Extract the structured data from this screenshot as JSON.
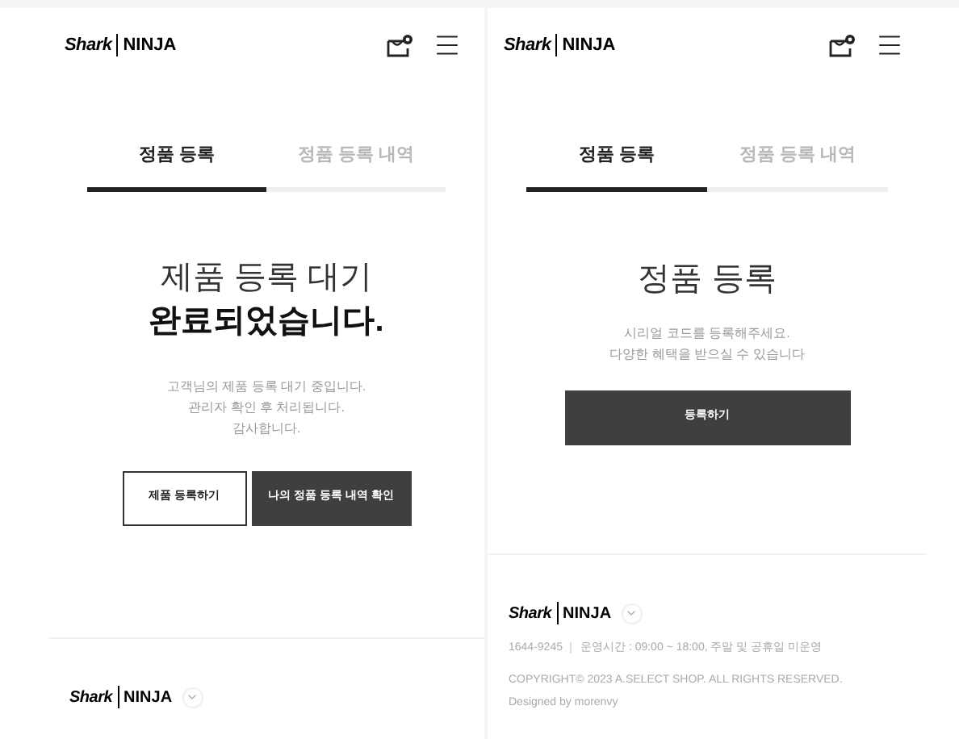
{
  "screens": [
    {
      "kind": "complete",
      "brand": {
        "left": "Shark",
        "right": "NINJA"
      },
      "tabs": [
        {
          "label": "정품 등록",
          "selected": true
        },
        {
          "label": "정품 등록 내역",
          "selected": false
        }
      ],
      "title": "제품 등록 대기",
      "title_bold": "완료되었습니다.",
      "message": [
        "고객님의 제품 등록 대기 중입니다.",
        "관리자 확인 후 처리됩니다.",
        "감사합니다."
      ],
      "buttons": [
        {
          "label": "제품 등록하기",
          "kind": "outline"
        },
        {
          "label": "나의 정품 등록 내역 확인",
          "kind": "filled"
        }
      ],
      "footer": {
        "brand": {
          "left": "Shark",
          "right": "NINJA"
        }
      }
    },
    {
      "kind": "register",
      "brand": {
        "left": "Shark",
        "right": "NINJA"
      },
      "tabs": [
        {
          "label": "정품 등록",
          "selected": true
        },
        {
          "label": "정품 등록 내역",
          "selected": false
        }
      ],
      "title": "정품 등록",
      "message": [
        "시리얼 코드를 등록해주세요.",
        "다양한 혜택을 받으실 수 있습니다"
      ],
      "buttons": [
        {
          "label": "등록하기",
          "kind": "filled"
        }
      ],
      "footer": {
        "brand": {
          "left": "Shark",
          "right": "NINJA"
        },
        "phone": "1644-9245",
        "hours": "운영시간 : 09:00 ~ 18:00, 주말 및 공휴일 미운영",
        "copyright": "COPYRIGHT© 2023 A.SELECT SHOP. ALL RIGHTS RESERVED.",
        "designer": "Designed by morenvy"
      }
    }
  ]
}
